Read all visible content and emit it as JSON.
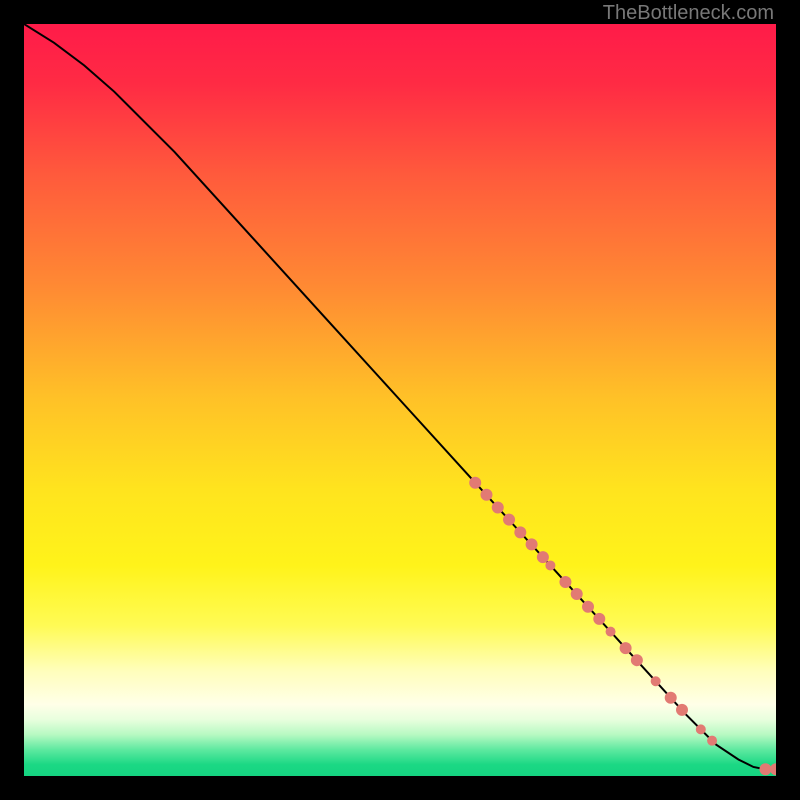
{
  "watermark": "TheBottleneck.com",
  "chart_data": {
    "type": "line",
    "title": "",
    "xlabel": "",
    "ylabel": "",
    "xlim": [
      0,
      100
    ],
    "ylim": [
      0,
      100
    ],
    "background_gradient": {
      "stops": [
        {
          "offset": 0.0,
          "color": "#ff1b49"
        },
        {
          "offset": 0.08,
          "color": "#ff2b44"
        },
        {
          "offset": 0.2,
          "color": "#ff5a3c"
        },
        {
          "offset": 0.35,
          "color": "#ff8a33"
        },
        {
          "offset": 0.5,
          "color": "#ffc227"
        },
        {
          "offset": 0.62,
          "color": "#ffe41e"
        },
        {
          "offset": 0.72,
          "color": "#fff31a"
        },
        {
          "offset": 0.8,
          "color": "#fffb55"
        },
        {
          "offset": 0.86,
          "color": "#fffebb"
        },
        {
          "offset": 0.905,
          "color": "#ffffe8"
        },
        {
          "offset": 0.925,
          "color": "#e8ffde"
        },
        {
          "offset": 0.945,
          "color": "#b7f9c2"
        },
        {
          "offset": 0.965,
          "color": "#5ee9a0"
        },
        {
          "offset": 0.985,
          "color": "#1bd884"
        },
        {
          "offset": 1.0,
          "color": "#15d481"
        }
      ]
    },
    "series": [
      {
        "name": "curve",
        "type": "line",
        "color": "#000000",
        "x": [
          0,
          4,
          8,
          12,
          20,
          30,
          40,
          50,
          60,
          70,
          80,
          88,
          92,
          95,
          97,
          98.5,
          100
        ],
        "y": [
          100,
          97.5,
          94.5,
          91,
          83,
          72,
          61,
          50,
          39,
          28,
          17,
          8.2,
          4.2,
          2.2,
          1.2,
          0.9,
          0.9
        ]
      },
      {
        "name": "markers",
        "type": "scatter",
        "color": "#e27a73",
        "points": [
          {
            "x": 60.0,
            "y": 39.0,
            "r": 6
          },
          {
            "x": 61.5,
            "y": 37.4,
            "r": 6
          },
          {
            "x": 63.0,
            "y": 35.7,
            "r": 6
          },
          {
            "x": 64.5,
            "y": 34.1,
            "r": 6
          },
          {
            "x": 66.0,
            "y": 32.4,
            "r": 6
          },
          {
            "x": 67.5,
            "y": 30.8,
            "r": 6
          },
          {
            "x": 69.0,
            "y": 29.1,
            "r": 6
          },
          {
            "x": 70.0,
            "y": 28.0,
            "r": 5
          },
          {
            "x": 72.0,
            "y": 25.8,
            "r": 6
          },
          {
            "x": 73.5,
            "y": 24.2,
            "r": 6
          },
          {
            "x": 75.0,
            "y": 22.5,
            "r": 6
          },
          {
            "x": 76.5,
            "y": 20.9,
            "r": 6
          },
          {
            "x": 78.0,
            "y": 19.2,
            "r": 5
          },
          {
            "x": 80.0,
            "y": 17.0,
            "r": 6
          },
          {
            "x": 81.5,
            "y": 15.4,
            "r": 6
          },
          {
            "x": 84.0,
            "y": 12.6,
            "r": 5
          },
          {
            "x": 86.0,
            "y": 10.4,
            "r": 6
          },
          {
            "x": 87.5,
            "y": 8.8,
            "r": 6
          },
          {
            "x": 90.0,
            "y": 6.2,
            "r": 5
          },
          {
            "x": 91.5,
            "y": 4.7,
            "r": 5
          },
          {
            "x": 98.6,
            "y": 0.9,
            "r": 6
          },
          {
            "x": 100.0,
            "y": 0.9,
            "r": 6
          }
        ]
      }
    ]
  }
}
